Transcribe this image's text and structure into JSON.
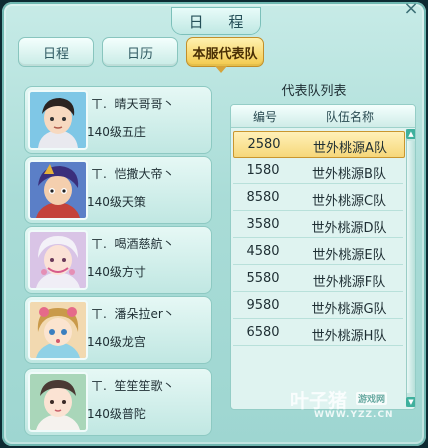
{
  "window": {
    "title": "日 程",
    "close_glyph": "×"
  },
  "tabs": [
    {
      "label": "日程",
      "active": false
    },
    {
      "label": "日历",
      "active": false
    },
    {
      "label": "本服代表队",
      "active": true
    }
  ],
  "members": [
    {
      "prefix": "ㄒ.",
      "name": "晴天哥哥丶",
      "level": "140级五庄"
    },
    {
      "prefix": "ㄒ.",
      "name": "恺撒大帝丶",
      "level": "140级天策"
    },
    {
      "prefix": "ㄒ.",
      "name": "喝酒慈航丶",
      "level": "140级方寸"
    },
    {
      "prefix": "ㄒ.",
      "name": "潘朵拉er丶",
      "level": "140级龙宫"
    },
    {
      "prefix": "ㄒ.",
      "name": "笙笙笙歌丶",
      "level": "140级普陀"
    }
  ],
  "team_list": {
    "title": "代表队列表",
    "columns": [
      "编号",
      "队伍名称"
    ],
    "rows": [
      {
        "id": "2580",
        "name": "世外桃源A队",
        "selected": true
      },
      {
        "id": "1580",
        "name": "世外桃源B队",
        "selected": false
      },
      {
        "id": "8580",
        "name": "世外桃源C队",
        "selected": false
      },
      {
        "id": "3580",
        "name": "世外桃源D队",
        "selected": false
      },
      {
        "id": "4580",
        "name": "世外桃源E队",
        "selected": false
      },
      {
        "id": "5580",
        "name": "世外桃源F队",
        "selected": false
      },
      {
        "id": "9580",
        "name": "世外桃源G队",
        "selected": false
      },
      {
        "id": "6580",
        "name": "世外桃源H队",
        "selected": false
      }
    ]
  },
  "watermark": {
    "main": "叶子猪",
    "badge": "游戏网",
    "url": "WWW.YZZ.CN"
  }
}
